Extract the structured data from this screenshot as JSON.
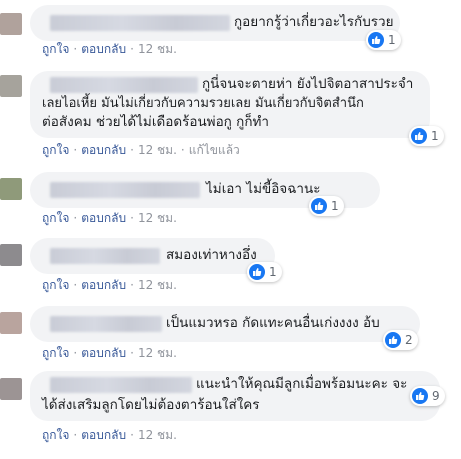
{
  "comments": [
    {
      "lines": [
        "กูอยากรู้ว่าเกี่ยวอะไรกับรวย"
      ],
      "like_label": "ถูกใจ",
      "reply_label": "ตอบกลับ",
      "time": "12 ชม.",
      "reactions": "1",
      "avatar_color": "#b0a29c"
    },
    {
      "lines": [
        "กูนี่จนจะตายห่า ยังไปจิตอาสาประจำ",
        "เลยไอเหี้ย มันไม่เกี่ยวกับความรวยเลย มันเกี่ยวกับจิตสำนึก",
        "ต่อสังคม ช่วยได้ไม่เดือดร้อนพ่อกู กูก็ทำ"
      ],
      "like_label": "ถูกใจ",
      "reply_label": "ตอบกลับ",
      "time": "12 ชม.",
      "edited": "แก้ไขแล้ว",
      "reactions": "1",
      "avatar_color": "#a6a39c"
    },
    {
      "lines": [
        "ไม่เอา ไม่ขี้อิจฉานะ"
      ],
      "like_label": "ถูกใจ",
      "reply_label": "ตอบกลับ",
      "time": "12 ชม.",
      "reactions": "1",
      "avatar_color": "#8f9a7a"
    },
    {
      "lines": [
        "สมองเท่าหางอึ่ง"
      ],
      "like_label": "ถูกใจ",
      "reply_label": "ตอบกลับ",
      "time": "12 ชม.",
      "reactions": "1",
      "avatar_color": "#8d8b8e"
    },
    {
      "lines": [
        "เป็นแมวหรอ กัดแทะคนอื่นเก่งงงง อ้บ"
      ],
      "like_label": "ถูกใจ",
      "reply_label": "ตอบกลับ",
      "time": "12 ชม.",
      "reactions": "2",
      "avatar_color": "#b9a49e"
    },
    {
      "lines": [
        "แนะนำให้คุณมีลูกเมื่อพร้อมนะคะ จะ",
        "ได้ส่งเสริมลูกโดยไม่ต้องตาร้อนใส่ใคร"
      ],
      "like_label": "ถูกใจ",
      "reply_label": "ตอบกลับ",
      "time": "12 ชม.",
      "reactions": "9",
      "avatar_color": "#9c9494"
    }
  ],
  "icons": {
    "like": "thumbs-up-icon"
  },
  "colors": {
    "like_blue": "#1877f2",
    "link": "#385898",
    "bubble": "#f2f3f5"
  }
}
